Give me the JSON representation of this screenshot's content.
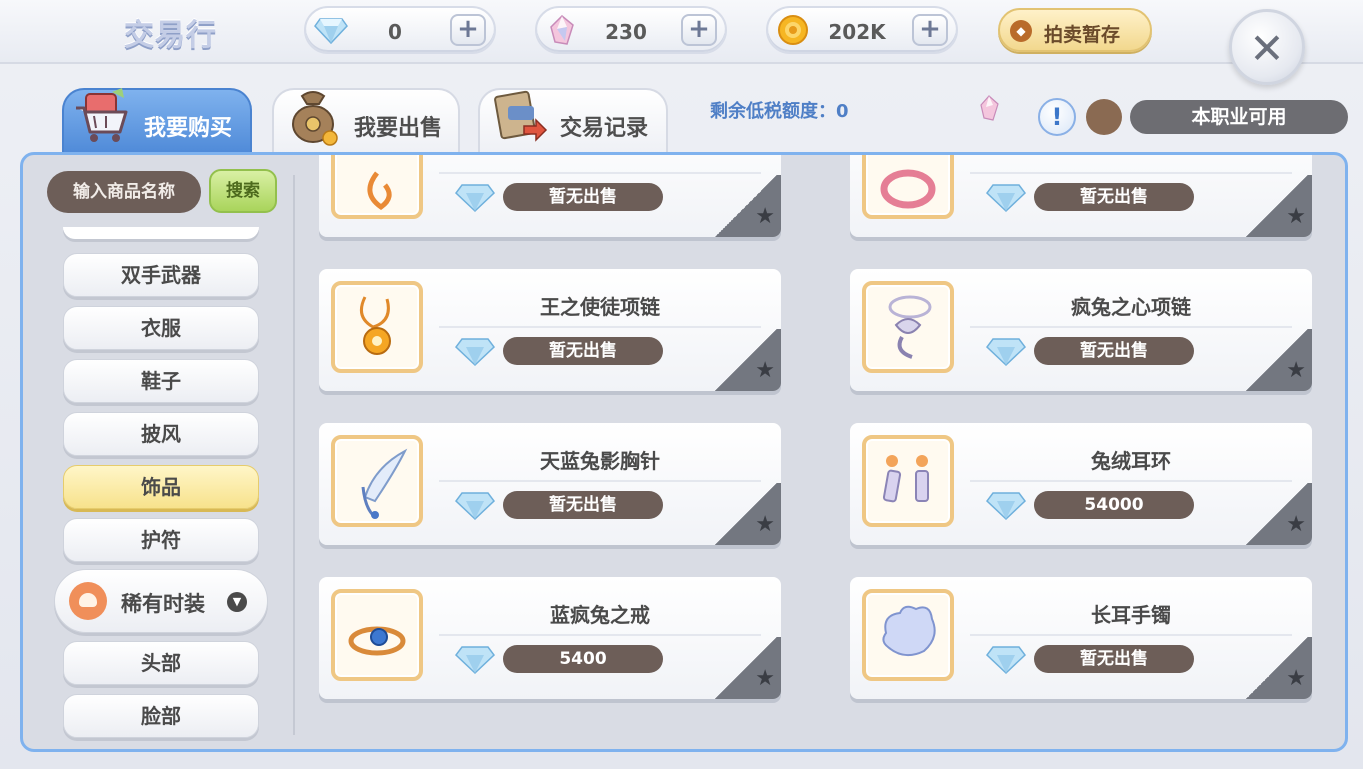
{
  "header": {
    "title": "交易行",
    "currencies": [
      {
        "icon": "diamond-icon",
        "value": "0"
      },
      {
        "icon": "crystal-icon",
        "value": "230"
      },
      {
        "icon": "gold-coin-icon",
        "value": "202K"
      }
    ],
    "plus_label": "+",
    "auction_label": "拍卖暂存",
    "close_label": "✕"
  },
  "tabs": [
    {
      "label": "我要购买",
      "active": true
    },
    {
      "label": "我要出售",
      "active": false
    },
    {
      "label": "交易记录",
      "active": false
    }
  ],
  "tax_label": "剩余低税额度：0",
  "info_label": "!",
  "job_filter_label": "本职业可用",
  "sidebar": {
    "search_placeholder": "输入商品名称",
    "search_button": "搜索",
    "categories": [
      "双手武器",
      "衣服",
      "鞋子",
      "披风",
      "饰品",
      "护符"
    ],
    "selected_category": "饰品",
    "group_label": "稀有时装",
    "group_items": [
      "头部",
      "脸部"
    ]
  },
  "items": [
    {
      "name": "",
      "price": "暂无出售"
    },
    {
      "name": "",
      "price": "暂无出售"
    },
    {
      "name": "王之使徒项链",
      "price": "暂无出售"
    },
    {
      "name": "疯兔之心项链",
      "price": "暂无出售"
    },
    {
      "name": "天蓝兔影胸针",
      "price": "暂无出售"
    },
    {
      "name": "兔绒耳环",
      "price": "54000"
    },
    {
      "name": "蓝疯兔之戒",
      "price": "5400"
    },
    {
      "name": "长耳手镯",
      "price": "暂无出售"
    }
  ],
  "colors": {
    "accent_blue": "#4f8ad8",
    "selected_yellow": "#f7e28c",
    "price_pill": "#6d5e58",
    "icon_border": "#efc784"
  }
}
